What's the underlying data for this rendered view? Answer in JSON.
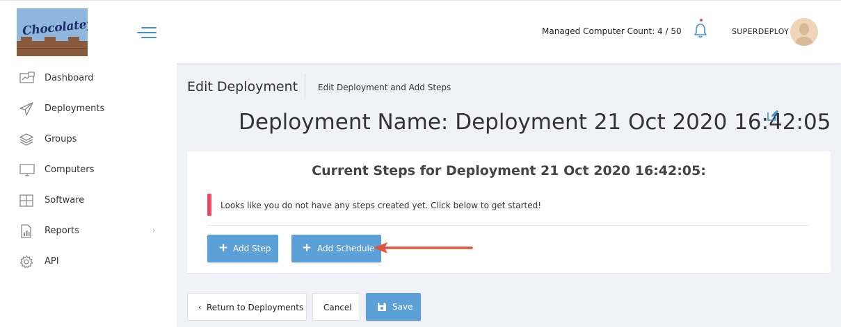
{
  "header": {
    "logo_text": "Chocolatey",
    "managed_label": "Managed Computer Count: 4 / 50",
    "username": "SUPERDEPLOY"
  },
  "sidebar": {
    "items": [
      {
        "label": "Dashboard",
        "icon": "dashboard-icon"
      },
      {
        "label": "Deployments",
        "icon": "paper-plane-icon"
      },
      {
        "label": "Groups",
        "icon": "layers-icon"
      },
      {
        "label": "Computers",
        "icon": "monitor-icon"
      },
      {
        "label": "Software",
        "icon": "grid-icon"
      },
      {
        "label": "Reports",
        "icon": "report-icon",
        "chevron": "›"
      },
      {
        "label": "API",
        "icon": "gear-icon"
      }
    ]
  },
  "main": {
    "title": "Edit Deployment",
    "subtitle": "Edit Deployment and Add Steps",
    "deployment_name": "Deployment Name: Deployment 21 Oct 2020 16:42:05",
    "card": {
      "title": "Current Steps for Deployment 21 Oct 2020 16:42:05:",
      "message": "Looks like you do not have any steps created yet. Click below to get started!",
      "add_step_label": "Add Step",
      "add_schedule_label": "Add Schedule"
    },
    "footer": {
      "return_label": "Return to Deployments",
      "cancel_label": "Cancel",
      "save_label": "Save"
    }
  },
  "colors": {
    "accent": "#5ba0d6",
    "callout": "#ea4b66",
    "arrow": "#e0533f"
  }
}
